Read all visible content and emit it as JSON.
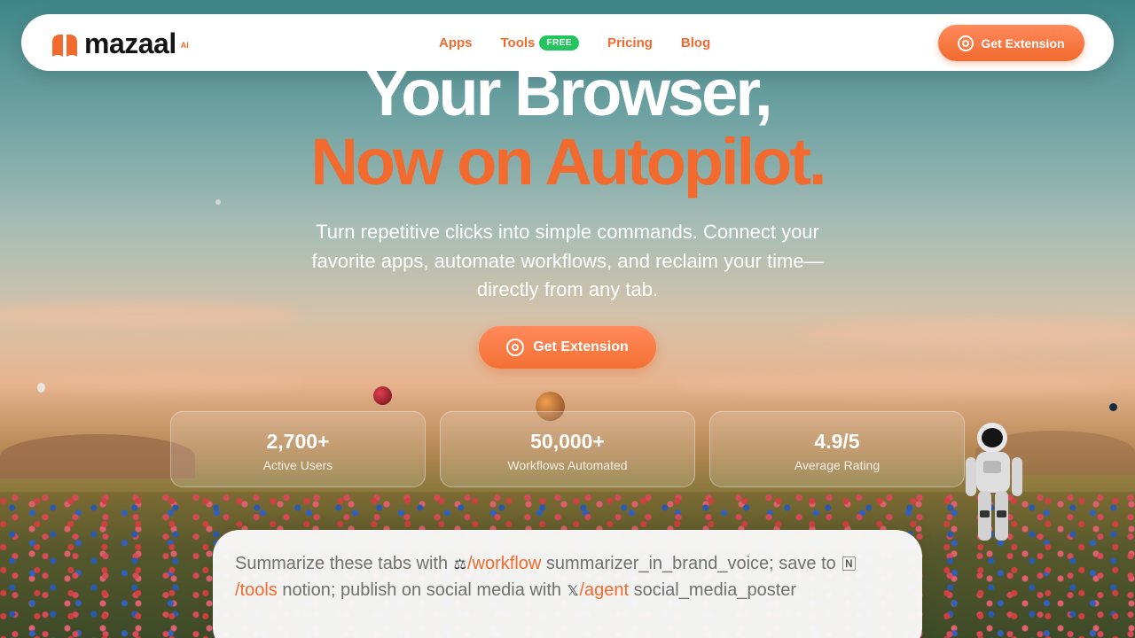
{
  "nav": {
    "logo_text": "mazaal",
    "logo_suffix": "AI",
    "links": [
      {
        "label": "Apps"
      },
      {
        "label": "Tools",
        "badge": "FREE"
      },
      {
        "label": "Pricing"
      },
      {
        "label": "Blog"
      }
    ],
    "cta_label": "Get Extension"
  },
  "hero": {
    "title_line1": "Your Browser,",
    "title_line2": "Now on Autopilot.",
    "subtitle": "Turn repetitive clicks into simple commands. Connect your favorite apps, automate workflows, and reclaim your time—directly from any tab.",
    "cta_label": "Get Extension"
  },
  "stats": [
    {
      "value": "2,700+",
      "label": "Active Users"
    },
    {
      "value": "50,000+",
      "label": "Workflows Automated"
    },
    {
      "value": "4.9/5",
      "label": "Average Rating"
    }
  ],
  "command": {
    "text_1": "Summarize these tabs with ",
    "icon_1": "scale-icon",
    "kw_1": "/workflow",
    "text_2": " summarizer_in_brand_voice; save to ",
    "icon_2": "notion-icon",
    "kw_2": "/tools",
    "text_3": " notion; publish on social media with ",
    "icon_3": "x-icon",
    "kw_3": "/agent",
    "text_4": " social_media_poster"
  },
  "colors": {
    "accent": "#f26a2e",
    "badge_green": "#22c55e",
    "white": "#ffffff"
  }
}
